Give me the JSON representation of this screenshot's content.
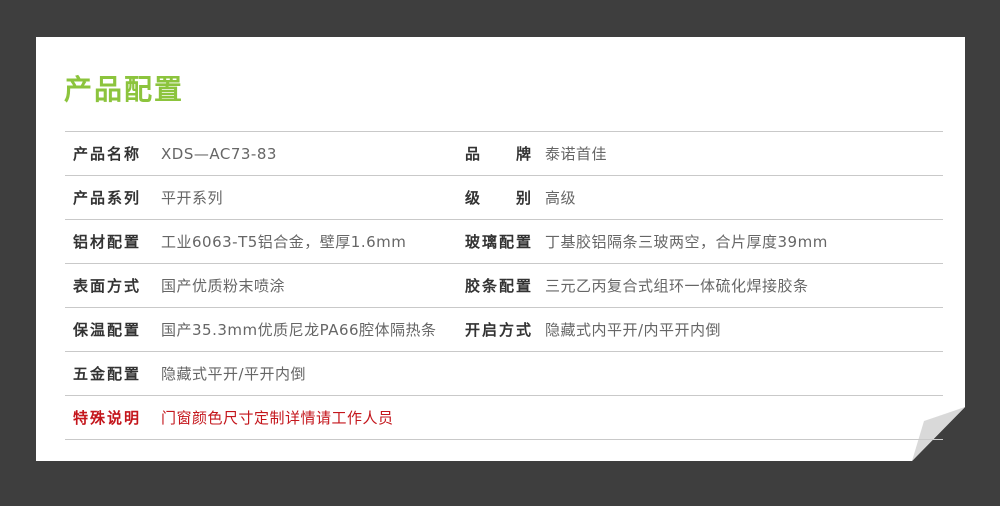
{
  "title": "产品配置",
  "rows": [
    {
      "label": "产品名称",
      "value": "XDS—AC73-83",
      "label2": [
        "品",
        "牌"
      ],
      "value2": "泰诺首佳"
    },
    {
      "label": "产品系列",
      "value": "平开系列",
      "label2": [
        "级",
        "别"
      ],
      "value2": "高级"
    },
    {
      "label": "铝材配置",
      "value": "工业6063-T5铝合金，壁厚1.6mm",
      "label2": "玻璃配置",
      "value2": "丁基胶铝隔条三玻两空，合片厚度39mm"
    },
    {
      "label": "表面方式",
      "value": "国产优质粉末喷涂",
      "label2": "胶条配置",
      "value2": "三元乙丙复合式组环一体硫化焊接胶条"
    },
    {
      "label": "保温配置",
      "value": "国产35.3mm优质尼龙PA66腔体隔热条",
      "label2": "开启方式",
      "value2": "隐藏式内平开/内平开内倒"
    },
    {
      "label": "五金配置",
      "value": "隐藏式平开/平开内倒"
    },
    {
      "label": "特殊说明",
      "value": "门窗颜色尺寸定制详情请工作人员"
    }
  ],
  "colors": {
    "accent": "#8cc43d",
    "special": "#c4161c",
    "background": "#3e3e3e"
  }
}
